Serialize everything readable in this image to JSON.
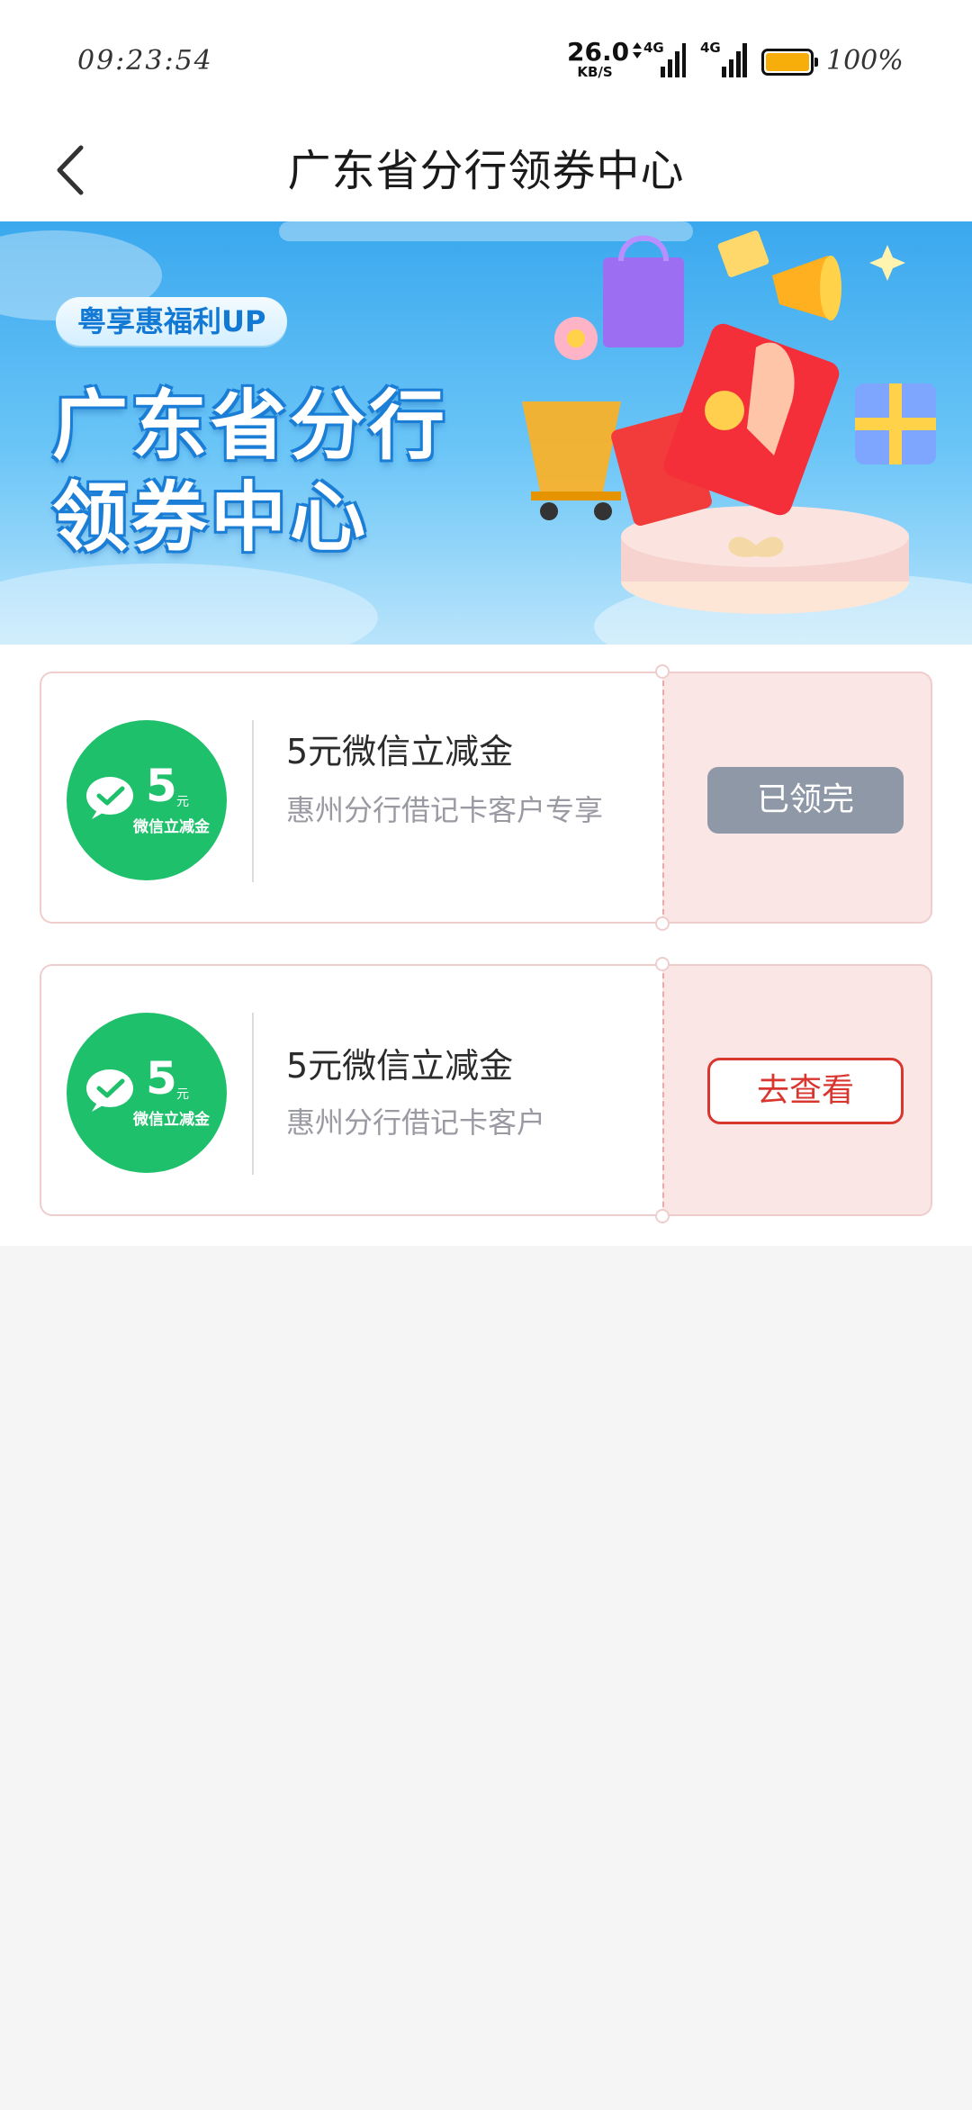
{
  "status_bar": {
    "time": "09:23:54",
    "net_speed_value": "26.0",
    "net_speed_unit": "KB/S",
    "signal1_label": "4G",
    "signal2_label": "4G",
    "battery_level": 1.0,
    "battery_percent": "100%",
    "battery_color": "#f8ae0a"
  },
  "nav": {
    "back_icon": "chevron-left-icon",
    "title": "广东省分行领券中心"
  },
  "banner": {
    "badge": "粤享惠福利UP",
    "line1": "广东省分行",
    "line2": "领券中心"
  },
  "coupons": [
    {
      "amount": "5",
      "unit": "元",
      "coin_label": "微信立减金",
      "title": "5元微信立减金",
      "description": "惠州分行借记卡客户专享",
      "action_label": "已领完",
      "action_state": "claimed"
    },
    {
      "amount": "5",
      "unit": "元",
      "coin_label": "微信立减金",
      "title": "5元微信立减金",
      "description": "惠州分行借记卡客户",
      "action_label": "去查看",
      "action_state": "available"
    }
  ],
  "colors": {
    "wechat_green": "#1ec06b",
    "accent_red": "#d9362f",
    "claimed_gray": "#8e98a6",
    "ticket_pink": "#fbe6e6"
  }
}
